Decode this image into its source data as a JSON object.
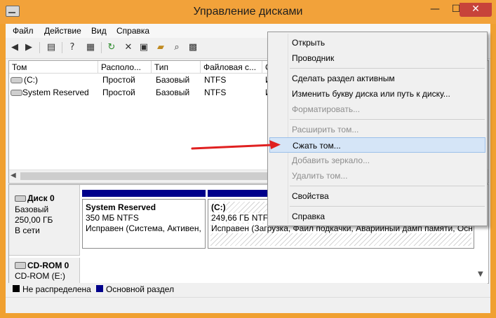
{
  "window": {
    "title": "Управление дисками",
    "controls": {
      "minimize": "—",
      "maximize": "☐",
      "close": "✕"
    }
  },
  "menubar": {
    "items": [
      "Файл",
      "Действие",
      "Вид",
      "Справка"
    ]
  },
  "toolbar": {
    "icons": [
      "back-arrow-icon",
      "forward-arrow-icon",
      "console-tree-icon",
      "help-icon",
      "properties-icon",
      "refresh-icon",
      "delete-icon",
      "new-icon",
      "open-folder-icon",
      "search-icon",
      "export-icon"
    ]
  },
  "volume_table": {
    "columns": [
      "Том",
      "Располо...",
      "Тип",
      "Файловая с...",
      "С"
    ],
    "rows": [
      {
        "name": "(C:)",
        "layout": "Простой",
        "type": "Базовый",
        "fs": "NTFS",
        "status": "И"
      },
      {
        "name": "System Reserved",
        "layout": "Простой",
        "type": "Базовый",
        "fs": "NTFS",
        "status": "И"
      }
    ]
  },
  "disks": [
    {
      "label": "Диск 0",
      "type": "Базовый",
      "size": "250,00 ГБ",
      "state": "В сети",
      "partitions": [
        {
          "name": "System Reserved",
          "size": "350 МБ NTFS",
          "status": "Исправен (Система, Активен,"
        },
        {
          "name": "(C:)",
          "size": "249,66 ГБ NTFS",
          "status": "Исправен (Загрузка, Файл подкачки, Аварийный дамп памяти, Осн"
        }
      ]
    },
    {
      "label": "CD-ROM 0",
      "type": "CD-ROM (E:)"
    }
  ],
  "legend": [
    {
      "label": "Не распределена",
      "color": "#000000"
    },
    {
      "label": "Основной раздел",
      "color": "#00008b"
    }
  ],
  "context_menu": {
    "items": [
      {
        "label": "Открыть",
        "enabled": true
      },
      {
        "label": "Проводник",
        "enabled": true
      },
      {
        "label": "Сделать раздел активным",
        "enabled": true
      },
      {
        "label": "Изменить букву диска или путь к диску...",
        "enabled": true
      },
      {
        "label": "Форматировать...",
        "enabled": false
      },
      {
        "label": "Расширить том...",
        "enabled": false
      },
      {
        "label": "Сжать том...",
        "enabled": true,
        "highlighted": true
      },
      {
        "label": "Добавить зеркало...",
        "enabled": false
      },
      {
        "label": "Удалить том...",
        "enabled": false
      },
      {
        "label": "Свойства",
        "enabled": true
      },
      {
        "label": "Справка",
        "enabled": true
      }
    ]
  },
  "colors": {
    "titlebar": "#f2a23a",
    "close_button": "#c7433a",
    "partition_header": "#00008b",
    "highlight": "#d5e5f7",
    "annotation_arrow": "#e02020"
  }
}
